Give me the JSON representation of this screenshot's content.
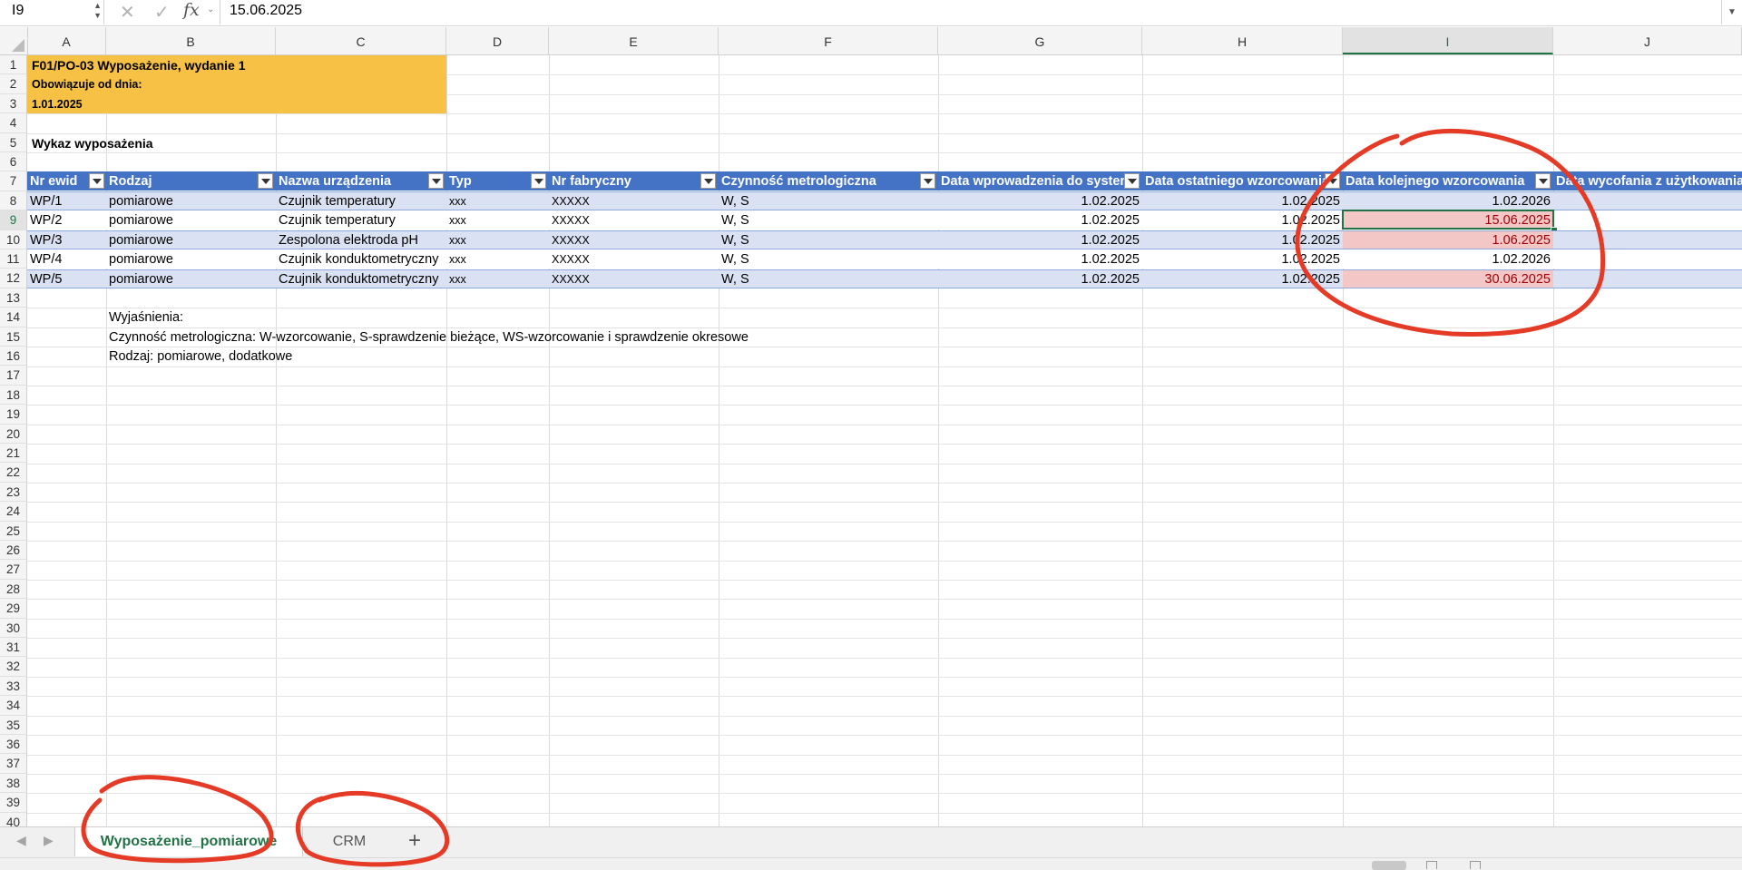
{
  "formula_bar": {
    "name_box": "I9",
    "fx_label": "fx",
    "formula": "15.06.2025"
  },
  "columns": [
    "A",
    "B",
    "C",
    "D",
    "E",
    "F",
    "G",
    "H",
    "I",
    "J"
  ],
  "selected_column": "I",
  "row_numbers": [
    "1",
    "2",
    "3",
    "4",
    "5",
    "6",
    "7",
    "8",
    "9",
    "10",
    "11",
    "12",
    "13",
    "14",
    "15",
    "16",
    "17",
    "18",
    "19",
    "20",
    "21",
    "22",
    "23",
    "24",
    "25",
    "26",
    "27",
    "28",
    "29",
    "30",
    "31",
    "32",
    "33",
    "34",
    "35",
    "36",
    "37",
    "38",
    "39",
    "40"
  ],
  "selected_row": "9",
  "header_block": {
    "title": "F01/PO-03 Wyposażenie, wydanie 1",
    "valid_from_label": "Obowiązuje od dnia:",
    "valid_from_date": "1.01.2025"
  },
  "section_title": "Wykaz wyposażenia",
  "table": {
    "headers": [
      "Nr ewid",
      "Rodzaj",
      "Nazwa urządzenia",
      "Typ",
      "Nr fabryczny",
      "Czynność metrologiczna",
      "Data wprowadzenia do systemu",
      "Data ostatniego wzorcowania",
      "Data kolejnego wzorcowania",
      "Data wycofania z użytkowania"
    ],
    "rows": [
      {
        "nr": "WP/1",
        "rodzaj": "pomiarowe",
        "nazwa": "Czujnik temperatury",
        "typ": "xxx",
        "fabr": "XXXXX",
        "czynnosc": "W, S",
        "wprow": "1.02.2025",
        "ostatnie": "1.02.2025",
        "kolejne": "1.02.2026",
        "wycof": "",
        "highlight": false
      },
      {
        "nr": "WP/2",
        "rodzaj": "pomiarowe",
        "nazwa": "Czujnik temperatury",
        "typ": "xxx",
        "fabr": "XXXXX",
        "czynnosc": "W, S",
        "wprow": "1.02.2025",
        "ostatnie": "1.02.2025",
        "kolejne": "15.06.2025",
        "wycof": "",
        "highlight": true
      },
      {
        "nr": "WP/3",
        "rodzaj": "pomiarowe",
        "nazwa": "Zespolona elektroda pH",
        "typ": "xxx",
        "fabr": "XXXXX",
        "czynnosc": "W, S",
        "wprow": "1.02.2025",
        "ostatnie": "1.02.2025",
        "kolejne": "1.06.2025",
        "wycof": "",
        "highlight": true
      },
      {
        "nr": "WP/4",
        "rodzaj": "pomiarowe",
        "nazwa": "Czujnik konduktometryczny",
        "typ": "xxx",
        "fabr": "XXXXX",
        "czynnosc": "W, S",
        "wprow": "1.02.2025",
        "ostatnie": "1.02.2025",
        "kolejne": "1.02.2026",
        "wycof": "",
        "highlight": false
      },
      {
        "nr": "WP/5",
        "rodzaj": "pomiarowe",
        "nazwa": "Czujnik konduktometryczny",
        "typ": "xxx",
        "fabr": "XXXXX",
        "czynnosc": "W, S",
        "wprow": "1.02.2025",
        "ostatnie": "1.02.2025",
        "kolejne": "30.06.2025",
        "wycof": "",
        "highlight": true
      }
    ]
  },
  "notes": {
    "heading": "Wyjaśnienia:",
    "line1": "Czynność metrologiczna: W-wzorcowanie, S-sprawdzenie bieżące, WS-wzorcowanie i sprawdzenie okresowe",
    "line2": "Rodzaj: pomiarowe, dodatkowe"
  },
  "sheet_tabs": {
    "active": "Wyposażenie_pomiarowe",
    "other": "CRM",
    "add": "+"
  },
  "colors": {
    "header_fill": "#f6c144",
    "table_header": "#4472c4",
    "band_fill": "#d9e1f2",
    "alert_fill": "#f4c7c7",
    "alert_text": "#9c0006",
    "annotation": "#e53a26",
    "accent": "#217346"
  }
}
